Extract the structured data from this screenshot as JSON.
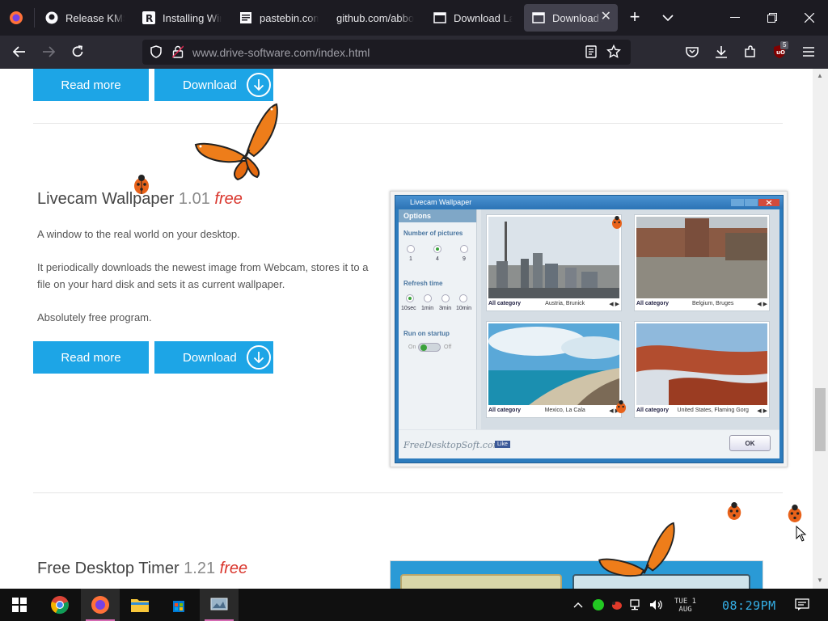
{
  "browser": {
    "tabs": [
      {
        "title": "Release KMSp"
      },
      {
        "title": "Installing Win"
      },
      {
        "title": "pastebin.com/"
      },
      {
        "title": "github.com/abbo"
      },
      {
        "title": "Download Lad"
      },
      {
        "title": "Download A",
        "active": true
      }
    ],
    "url": {
      "host": "www.drive-software.com",
      "path": "/index.html"
    },
    "extension_badge": "5"
  },
  "page": {
    "top_buttons": {
      "read_more": "Read more",
      "download": "Download"
    },
    "product1": {
      "name": "Livecam Wallpaper",
      "version": "1.01",
      "price": "free",
      "paragraphs": [
        "A window to the real world on your desktop.",
        "It periodically downloads the newest image from Webcam, stores it to a file on your hard disk and sets it as current wallpaper.",
        "Absolutely free program."
      ],
      "read_more": "Read more",
      "download": "Download",
      "screenshot": {
        "window_title": "Livecam Wallpaper",
        "options_header": "Options",
        "number_label": "Number of pictures",
        "number_options": [
          "1",
          "4",
          "9"
        ],
        "refresh_label": "Refresh time",
        "refresh_options": [
          "10sec",
          "1min",
          "3min",
          "10min"
        ],
        "startup_label": "Run on startup",
        "toggle_on": "On",
        "toggle_off": "Off",
        "pictures": [
          {
            "category": "All category",
            "location": "Austria, Brunick"
          },
          {
            "category": "All category",
            "location": "Belgium, Bruges"
          },
          {
            "category": "All category",
            "location": "Mexico, La Cala"
          },
          {
            "category": "All category",
            "location": "United States, Flaming Gorg"
          }
        ],
        "brand": "FreeDesktopSoft.com",
        "fb_like": "Like",
        "ok": "OK"
      }
    },
    "product2": {
      "name": "Free Desktop Timer",
      "version": "1.21",
      "price": "free"
    }
  },
  "taskbar": {
    "date_line1": "TUE 1",
    "date_line2": "AUG",
    "time": "08:29PM"
  },
  "colors": {
    "accent_blue": "#1da5e6",
    "free_red": "#d9342b",
    "tab_bg": "#1c1b22",
    "nav_bg": "#2b2a33"
  }
}
